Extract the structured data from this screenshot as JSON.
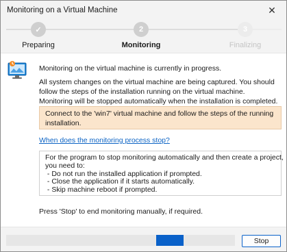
{
  "window": {
    "title": "Monitoring on a Virtual Machine",
    "close_glyph": "✕"
  },
  "stepper": {
    "steps": [
      {
        "label": "Preparing",
        "marker": "✓",
        "state": "done"
      },
      {
        "label": "Monitoring",
        "marker": "2",
        "state": "current"
      },
      {
        "label": "Finalizing",
        "marker": "3",
        "state": "pending"
      }
    ]
  },
  "content": {
    "icon": "monitor-capture-icon",
    "status_text": "Monitoring on the virtual machine is currently in progress.",
    "description": "All system changes on the virtual machine are being captured. You should follow the steps of the installation running on the virtual machine. Monitoring will be stopped automatically when the installation is completed.",
    "info_text": "Connect to the 'win7' virtual machine and follow the steps of the running installation.",
    "link_text": "When does the monitoring process stop?",
    "note_lines": [
      "For the program to stop monitoring automatically and then create a project,",
      "you need to:",
      " - Do not run the installed application if prompted.",
      " - Close the application if it starts automatically.",
      " - Skip machine reboot if prompted."
    ],
    "stop_hint": "Press 'Stop' to end monitoring manually, if required."
  },
  "footer": {
    "progress_fill_start": 0.655,
    "progress_fill_end": 0.775,
    "stop_label": "Stop"
  },
  "colors": {
    "accent": "#0a61c9",
    "step_done": "#cfcfcf",
    "step_current": "#cfcfcf",
    "step_pending": "#ececec",
    "info_bg": "#fbe5cc",
    "link": "#0b63c4"
  }
}
